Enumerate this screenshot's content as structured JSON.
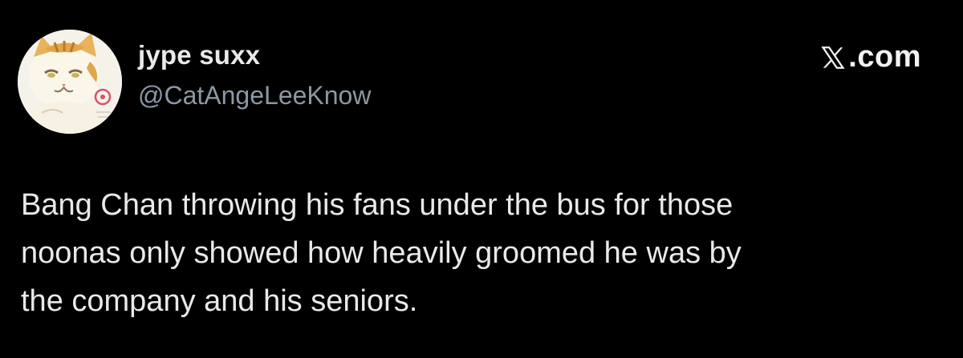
{
  "tweet": {
    "author": {
      "display_name": "jype suxx",
      "handle": "@CatAngeLeeKnow",
      "avatar_icon": "cartoon-cat-avatar"
    },
    "brand": {
      "text": ".com",
      "logo_icon": "x-logo-icon",
      "logo_letter": "X"
    },
    "body_lines": [
      "Bang Chan throwing his fans under the bus for those",
      "noonas only showed how heavily groomed he was by",
      "the company and his seniors."
    ]
  },
  "colors": {
    "background": "#000000",
    "text_primary": "#e7e9ea",
    "text_secondary": "#8b98a5"
  }
}
